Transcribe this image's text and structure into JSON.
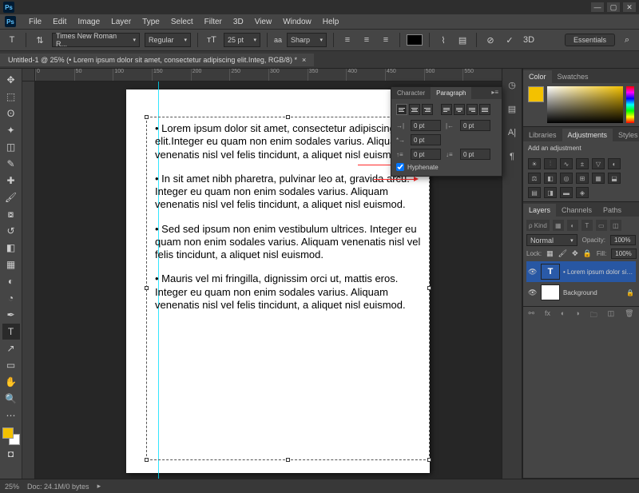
{
  "menu": {
    "items": [
      "File",
      "Edit",
      "Image",
      "Layer",
      "Type",
      "Select",
      "Filter",
      "3D",
      "View",
      "Window",
      "Help"
    ]
  },
  "win_controls": {
    "min": "—",
    "max": "▢",
    "close": "✕"
  },
  "options_bar": {
    "tool": "T",
    "font_family": "Times New Roman R...",
    "font_style": "Regular",
    "font_size": "25 pt",
    "aa_label": "aa",
    "aa_value": "Sharp",
    "workspace": "Essentials"
  },
  "doc_tab": {
    "title": "Untitled-1 @ 25% (• Lorem ipsum dolor sit amet, consectetur adipiscing elit.Integ, RGB/8) *",
    "close": "×"
  },
  "ruler_h": [
    "0",
    "50",
    "100",
    "150",
    "200",
    "250",
    "300",
    "350",
    "400",
    "450",
    "500",
    "550"
  ],
  "text_paragraphs": [
    "• Lorem ipsum dolor sit amet, consectetur adipiscing elit.Integer eu quam non enim sodales varius. Ali­quam venenatis nisl vel felis tincidunt, a aliquet nisl euismod.",
    "• In sit amet nibh pharetra, pulvinar leo at, gravida arcu. Integer eu quam non enim sodales varius. Ali­quam venenatis nisl vel felis tincidunt, a aliquet nisl euismod.",
    "• Sed sed ipsum non enim vestibulum ultrices. Inte­ger eu quam non enim sodales varius. Aliquam venenatis nisl vel felis tincidunt, a aliquet nisl euis­mod.",
    "• Mauris vel mi fringilla, dignissim orci ut, mattis eros. Integer eu quam non enim sodales varius. Ali­quam venenatis nisl vel felis tincidunt, a aliquet nisl euismod."
  ],
  "color_panel": {
    "tab_color": "Color",
    "tab_swatches": "Swatches"
  },
  "adjustments_panel": {
    "tab_libraries": "Libraries",
    "tab_adjustments": "Adjustments",
    "tab_styles": "Styles",
    "heading": "Add an adjustment"
  },
  "layers_panel": {
    "tab_layers": "Layers",
    "tab_channels": "Channels",
    "tab_paths": "Paths",
    "kind_label": "ρ Kind",
    "blend_mode": "Normal",
    "opacity_label": "Opacity:",
    "opacity_value": "100%",
    "lock_label": "Lock:",
    "fill_label": "Fill:",
    "fill_value": "100%",
    "rows": [
      {
        "eye": "👁",
        "thumbT": "T",
        "name": "• Lorem ipsum dolor sit am...",
        "active": true
      },
      {
        "eye": "👁",
        "thumbT": "",
        "name": "Background",
        "lock": "🔒",
        "active": false
      }
    ]
  },
  "paragraph_panel": {
    "tab_character": "Character",
    "tab_paragraph": "Paragraph",
    "indent_left": "0 pt",
    "indent_right": "0 pt",
    "indent_first": "0 pt",
    "space_before": "0 pt",
    "space_after": "0 pt",
    "hyphenate_label": "Hyphenate"
  },
  "statusbar": {
    "zoom": "25%",
    "doc_info": "Doc: 24.1M/0 bytes"
  }
}
